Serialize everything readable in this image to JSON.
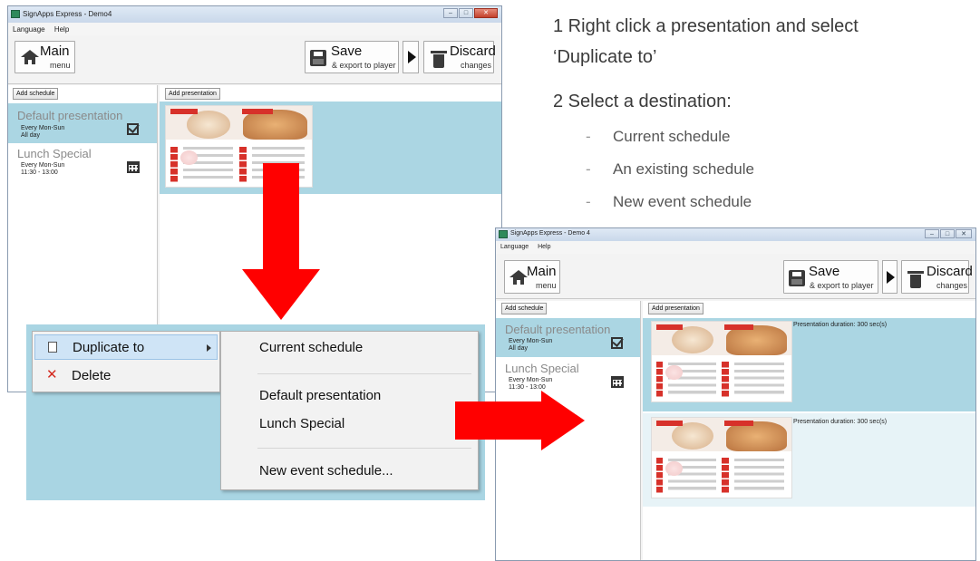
{
  "window_left": {
    "title": "SignApps Express - Demo4",
    "menu": [
      "Language",
      "Help"
    ],
    "main_menu": {
      "big": "Main",
      "small": "menu"
    },
    "save": {
      "big": "Save",
      "small": "& export to player"
    },
    "discard": {
      "big": "Discard",
      "small": "changes"
    },
    "add_schedule": "Add schedule",
    "add_presentation": "Add presentation",
    "schedules": [
      {
        "name": "Default presentation",
        "days": "Every Mon-Sun",
        "time": "All day",
        "icon": "checkbox-icon"
      },
      {
        "name": "Lunch Special",
        "days": "Every Mon-Sun",
        "time": "11:30 - 13:00",
        "icon": "calendar-icon"
      }
    ]
  },
  "window_right": {
    "title": "SignApps Express - Demo 4",
    "menu": [
      "Language",
      "Help"
    ],
    "main_menu": {
      "big": "Main",
      "small": "menu"
    },
    "save": {
      "big": "Save",
      "small": "& export to player"
    },
    "discard": {
      "big": "Discard",
      "small": "changes"
    },
    "add_schedule": "Add schedule",
    "add_presentation": "Add presentation",
    "schedules": [
      {
        "name": "Default presentation",
        "days": "Every Mon-Sun",
        "time": "All day",
        "icon": "checkbox-icon"
      },
      {
        "name": "Lunch Special",
        "days": "Every Mon-Sun",
        "time": "11:30 - 13:00",
        "icon": "calendar-icon"
      }
    ],
    "presentations": [
      {
        "duration": "Presentation duration: 300 sec(s)"
      },
      {
        "duration": "Presentation duration: 300 sec(s)"
      }
    ]
  },
  "context_menu": {
    "items": [
      {
        "label": "Duplicate to",
        "icon": "duplicate-icon"
      },
      {
        "label": "Delete",
        "icon": "delete-icon"
      }
    ],
    "submenu": {
      "current": "Current schedule",
      "schedules": [
        "Default presentation",
        "Lunch Special"
      ],
      "new": "New event schedule..."
    }
  },
  "instructions": {
    "step1_line1": "1  Right click a presentation and select",
    "step1_line2": "‘Duplicate to’",
    "step2": "2  Select a destination:",
    "options": [
      "Current schedule",
      "An existing schedule",
      "New event schedule"
    ],
    "dash": "-"
  },
  "colors": {
    "accent_red": "#ff0000",
    "selection_blue": "#abd6e3",
    "delete_red": "#d42a20"
  }
}
